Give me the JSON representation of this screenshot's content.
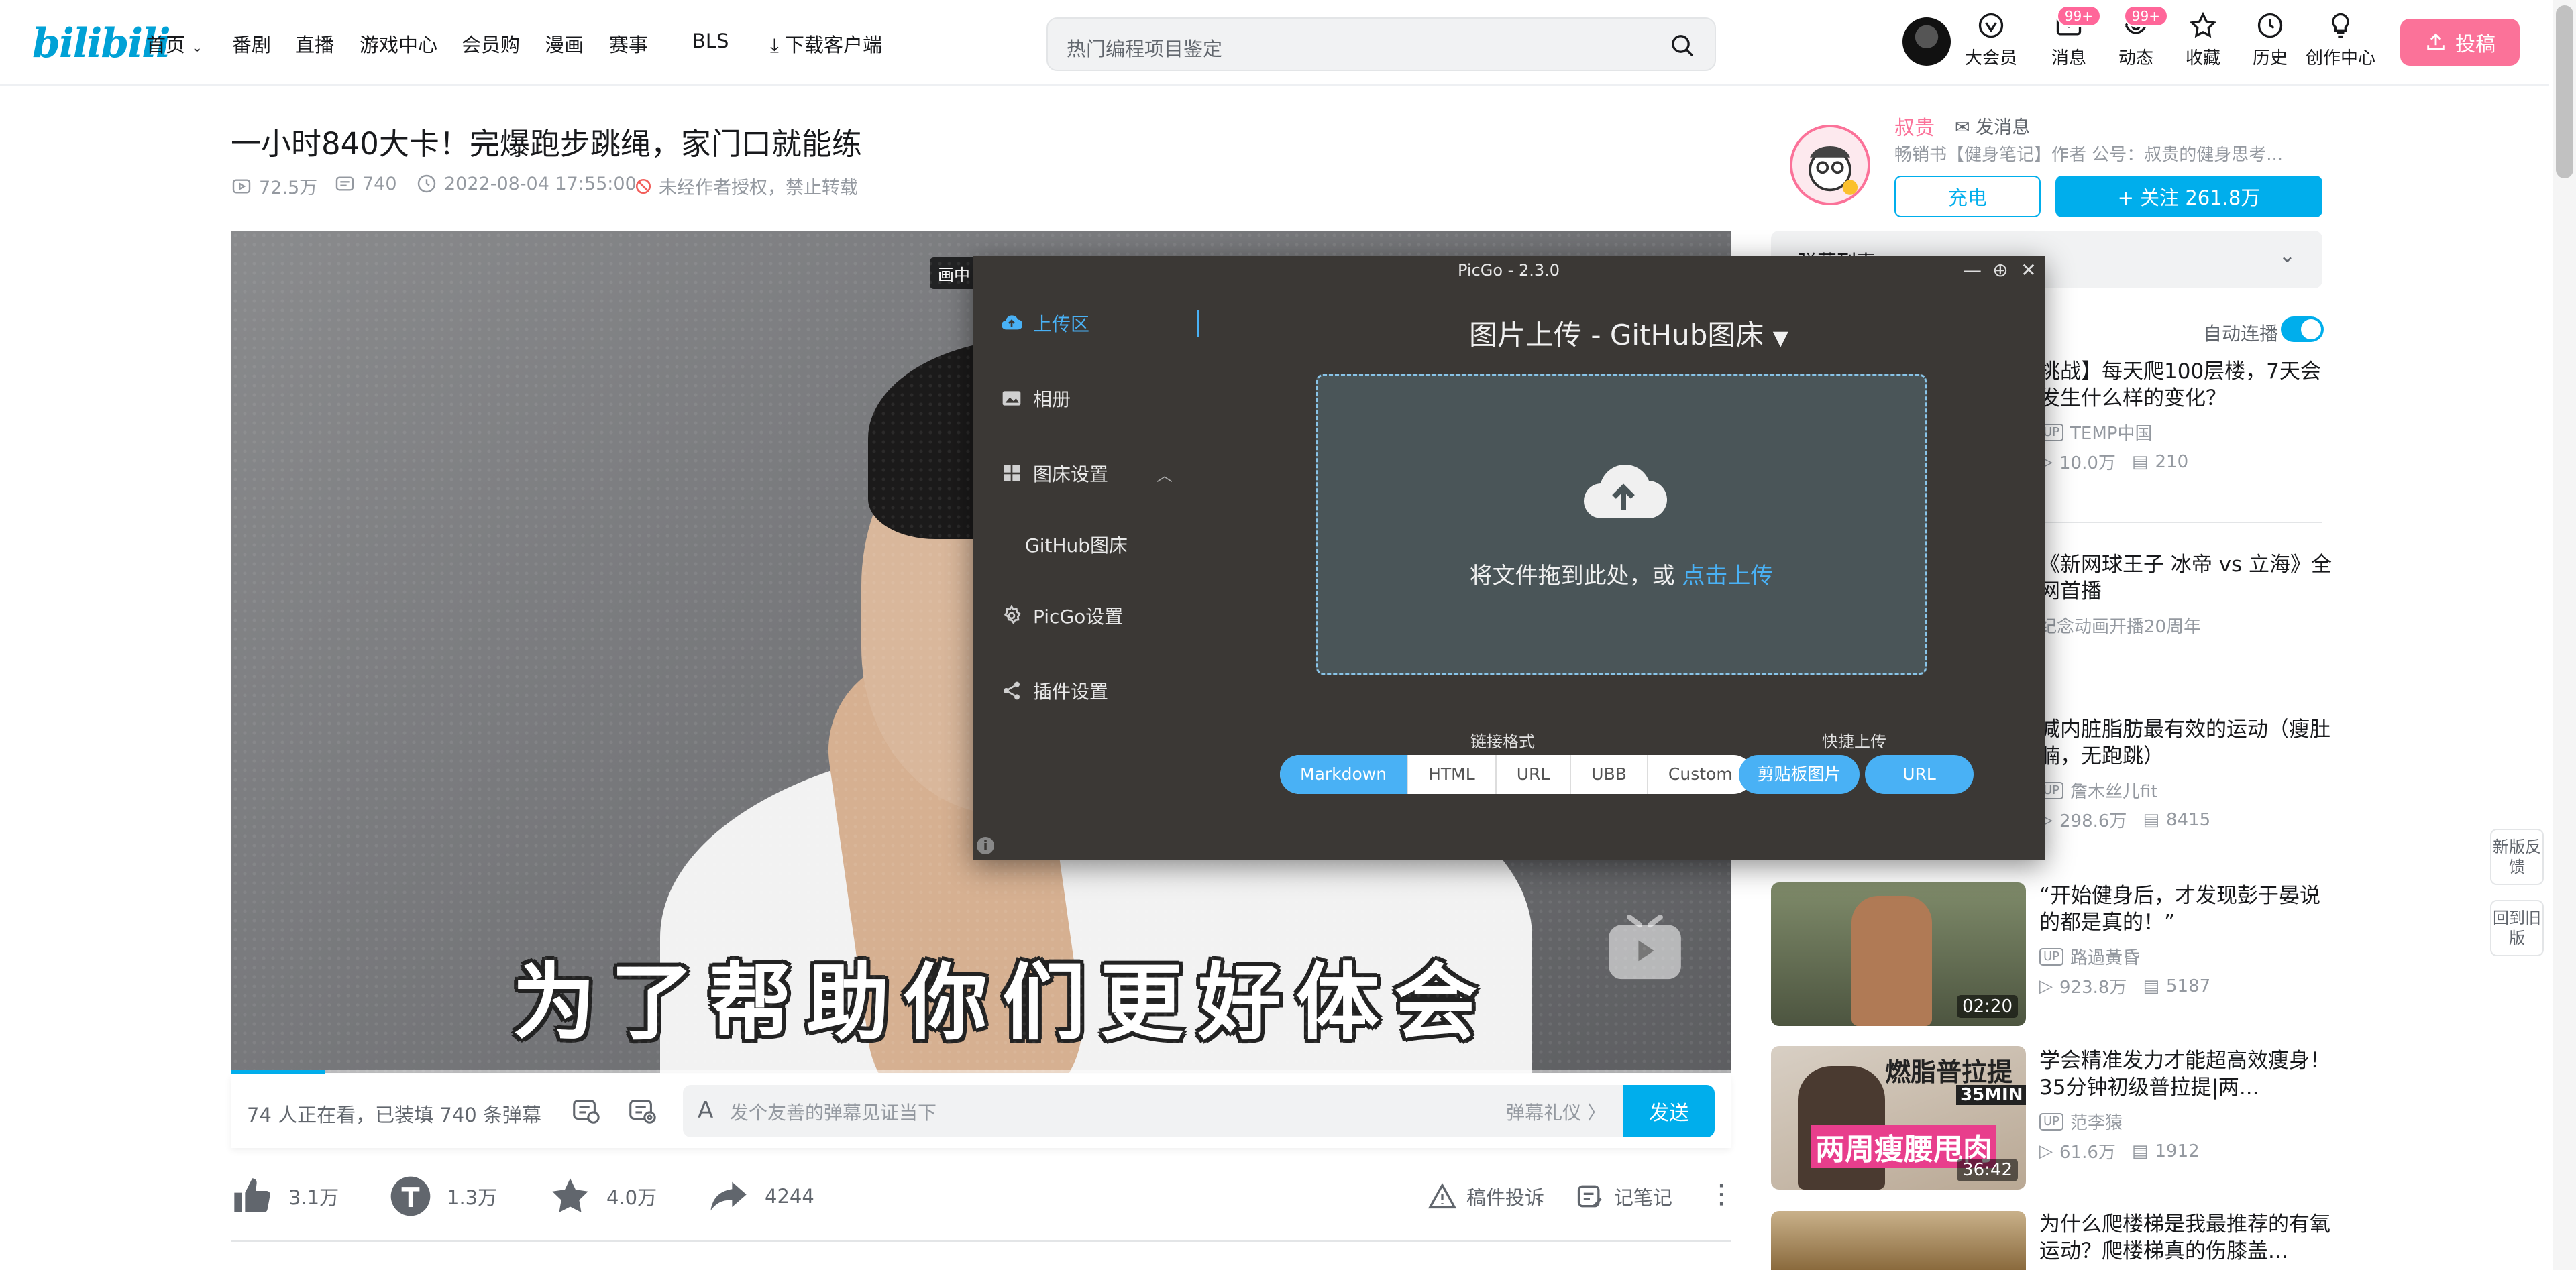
{
  "nav": {
    "logo": "bilibili",
    "items": [
      "首页",
      "番剧",
      "直播",
      "游戏中心",
      "会员购",
      "漫画",
      "赛事",
      "BLS",
      "下载客户端"
    ],
    "search_placeholder": "热门编程项目鉴定",
    "right_items": [
      {
        "label": "大会员",
        "icon": "vip-icon"
      },
      {
        "label": "消息",
        "icon": "message-icon",
        "badge": "99+"
      },
      {
        "label": "动态",
        "icon": "dynamic-icon",
        "badge": "99+"
      },
      {
        "label": "收藏",
        "icon": "star-icon"
      },
      {
        "label": "历史",
        "icon": "history-icon"
      },
      {
        "label": "创作中心",
        "icon": "bulb-icon"
      }
    ],
    "upload_label": "投稿"
  },
  "video": {
    "title": "一小时840大卡！完爆跑步跳绳，家门口就能练",
    "views": "72.5万",
    "danmaku": "740",
    "date": "2022-08-04 17:55:00",
    "copyright": "未经作者授权，禁止转载",
    "subtitle": "为了帮助你们更好体会",
    "pip_label": "画中"
  },
  "danmaku_bar": {
    "count_text": "74 人正在看，已装填 740 条弹幕",
    "input_placeholder": "发个友善的弹幕见证当下",
    "gift_label": "弹幕礼仪 〉",
    "send_label": "发送"
  },
  "actions": {
    "like": "3.1万",
    "coin": "1.3万",
    "fav": "4.0万",
    "share": "4244",
    "report": "稿件投诉",
    "note": "记笔记"
  },
  "uploader": {
    "name": "叔贵",
    "message": "发消息",
    "desc": "畅销书【健身笔记】作者 公号：叔贵的健身思考...",
    "charge": "充电",
    "follow": "+ 关注 261.8万"
  },
  "danmaku_list_label": "弹幕列表",
  "autoplay_label": "自动连播",
  "recommendations": [
    {
      "title": "挑战】每天爬100层楼，7天会发生什么样的变化？",
      "up": "TEMP中国",
      "views": "10.0万",
      "danmaku": "210"
    },
    {
      "title": "《新网球王子 冰帝 vs 立海》全网首播",
      "up": "纪念动画开播20周年",
      "views": "",
      "danmaku": ""
    },
    {
      "title": "减内脏脂肪最有效的运动（瘦肚腩，无跑跳）",
      "up": "詹木丝儿fit",
      "views": "298.6万",
      "danmaku": "8415"
    },
    {
      "title": "“开始健身后，才发现彭于晏说的都是真的！”",
      "up": "路過黃昏",
      "views": "923.8万",
      "danmaku": "5187",
      "duration": "02:20"
    },
    {
      "title": "学会精准发力才能超高效瘦身！35分钟初级普拉提|两...",
      "up": "范李猿",
      "views": "61.6万",
      "danmaku": "1912",
      "duration": "36:42",
      "thumb_text_top": "燃脂普拉提",
      "thumb_badge": "35MIN",
      "thumb_text_bottom": "两周瘦腰甩肉"
    },
    {
      "title": "为什么爬楼梯是我最推荐的有氧运动？爬楼梯真的伤膝盖...",
      "up": "",
      "views": "",
      "danmaku": ""
    }
  ],
  "side_tools": [
    "新版反馈",
    "回到旧版"
  ],
  "picgo": {
    "title": "PicGo - 2.3.0",
    "menu": [
      {
        "label": "上传区",
        "icon": "cloud-upload-icon"
      },
      {
        "label": "相册",
        "icon": "picture-icon"
      },
      {
        "label": "图床设置",
        "icon": "grid-icon"
      },
      {
        "label": "GitHub图床",
        "icon": ""
      },
      {
        "label": "PicGo设置",
        "icon": "settings-icon"
      },
      {
        "label": "插件设置",
        "icon": "share-icon"
      }
    ],
    "heading": "图片上传 - GitHub图床",
    "drop_text": "将文件拖到此处，或 ",
    "drop_link": "点击上传",
    "link_format_label": "链接格式",
    "link_formats": [
      "Markdown",
      "HTML",
      "URL",
      "UBB",
      "Custom"
    ],
    "quick_upload_label": "快捷上传",
    "quick_buttons": [
      "剪贴板图片",
      "URL"
    ]
  },
  "colors": {
    "brand_pink": "#fb7299",
    "brand_blue": "#00aeec",
    "picgo_accent": "#49b1f5"
  }
}
